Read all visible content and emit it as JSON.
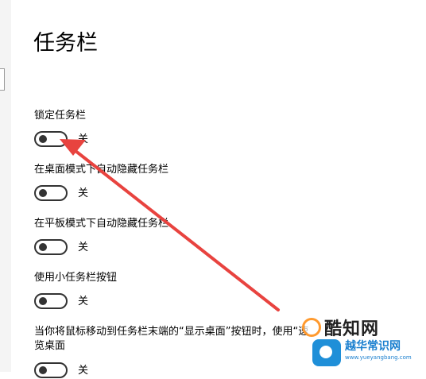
{
  "page": {
    "title": "任务栏"
  },
  "settings": [
    {
      "label": "锁定任务栏",
      "state_label": "关",
      "on": false
    },
    {
      "label": "在桌面模式下自动隐藏任务栏",
      "state_label": "关",
      "on": false
    },
    {
      "label": "在平板模式下自动隐藏任务栏",
      "state_label": "关",
      "on": false
    },
    {
      "label": "使用小任务栏按钮",
      "state_label": "关",
      "on": false
    },
    {
      "label_line1": "当你将鼠标移动到任务栏末端的“显示桌面”按钮时，使用“速",
      "label_line2": "览桌面",
      "state_label": "关",
      "on": false
    }
  ],
  "watermarks": {
    "brand1": "酷知网",
    "brand2": "越华常识网",
    "brand2_url": "www.yueyangbang.com"
  },
  "colors": {
    "annotation_arrow": "#e8433f",
    "toggle_off": "#333333",
    "brand1_logo": "#ff9a2f",
    "brand2_blue": "#1a7fcf"
  }
}
